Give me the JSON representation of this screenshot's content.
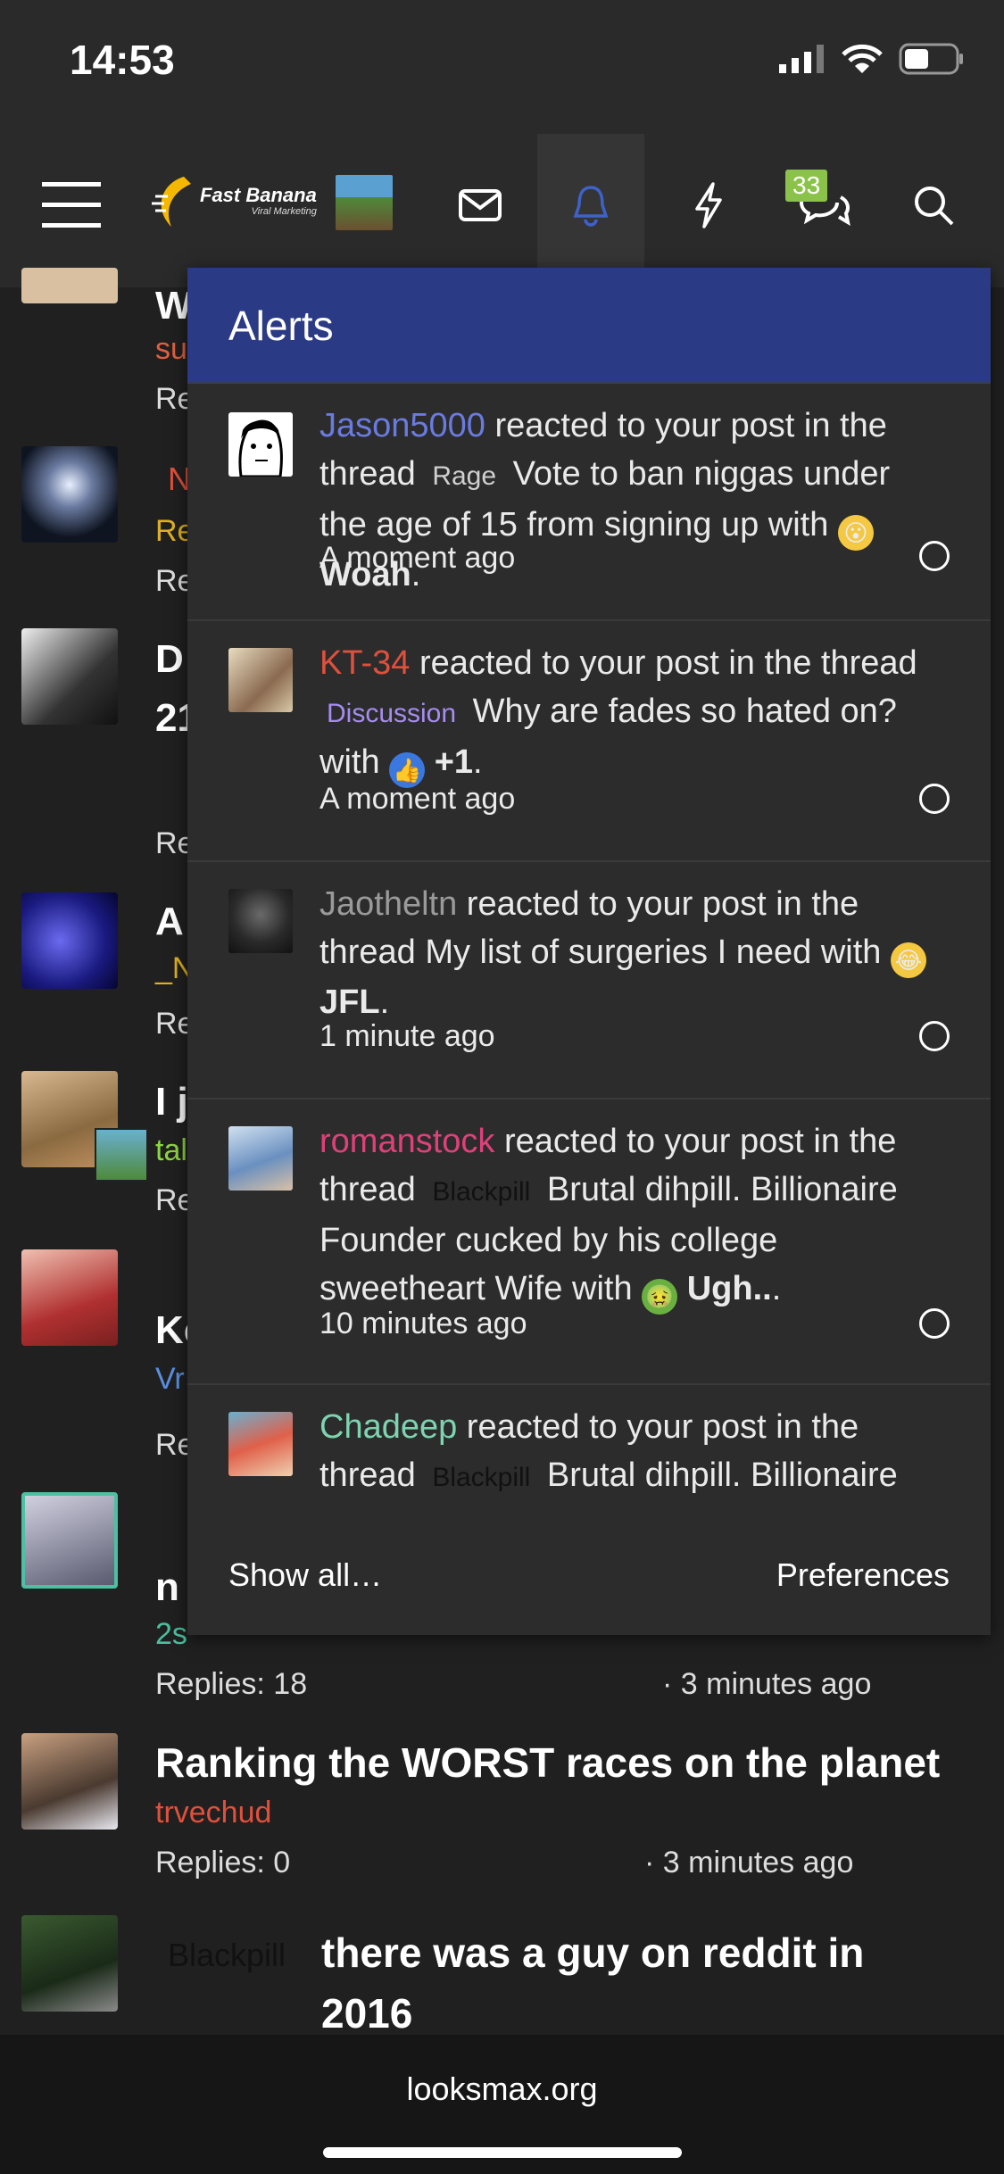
{
  "status": {
    "time": "14:53"
  },
  "nav": {
    "logo_title": "Fast Banana",
    "logo_subtitle": "Viral Marketing",
    "badge_count": "33"
  },
  "threads": [
    {
      "title": "W",
      "author": "su",
      "meta": "Re",
      "author_color": "#e06040"
    },
    {
      "title": "N",
      "author": "Re",
      "meta": "Re",
      "author_color": "#e0b020"
    },
    {
      "title": "D",
      "author": "21",
      "meta": "Re",
      "author_color": "#ffffff"
    },
    {
      "title": "A",
      "author": "_N",
      "meta": "Re",
      "author_color": "#e0b020"
    },
    {
      "title": "I j",
      "author": "tal",
      "meta": "Re",
      "author_color": "#8cd640"
    },
    {
      "title": "Ke",
      "author": "Vr",
      "meta": "Re",
      "author_color": "#5a8fe0"
    },
    {
      "title": "n",
      "author": "2s",
      "meta": "Replies: 18",
      "time": "· 3 minutes ago",
      "author_color": "#4cc0a0"
    },
    {
      "title": "Ranking the WORST races on the planet",
      "author": "trvechud",
      "meta": "Replies: 0",
      "time": "· 3 minutes ago",
      "author_color": "#e0503c"
    },
    {
      "title_prefix": "Blackpill",
      "title": "there was a guy on reddit in 2016",
      "author": "",
      "meta": ""
    }
  ],
  "alerts": {
    "title": "Alerts",
    "items": [
      {
        "user": "Jason5000",
        "user_color": "#6a7be0",
        "text1": " reacted to your post in the thread ",
        "prefix": "Rage",
        "prefix_color": "#cfcfcf",
        "thread": " Vote to ban niggas under the age of 15 from signing up with ",
        "reaction": "Woah",
        "emoji": "😮",
        "time": "A moment ago"
      },
      {
        "user": "KT-34",
        "user_color": "#e0503c",
        "text1": " reacted to your post in the thread ",
        "prefix": "Discussion",
        "prefix_color": "#a68cf0",
        "thread": " Why are fades so hated on? with ",
        "reaction": "+1",
        "emoji": "👍",
        "time": "A moment ago"
      },
      {
        "user": "Jaotheltn",
        "user_color": "#9a9a9a",
        "text1": " reacted to your post in the thread ",
        "prefix": "",
        "prefix_color": "",
        "thread": "My list of surgeries I need with ",
        "reaction": "JFL",
        "emoji": "😂",
        "time": "1 minute ago"
      },
      {
        "user": "romanstock",
        "user_color": "#e0407a",
        "text1": " reacted to your post in the thread ",
        "prefix": "Blackpill",
        "prefix_color": "#111111",
        "thread": " Brutal dihpill. Billionaire Founder cucked by his college sweetheart Wife with ",
        "reaction": "Ugh..",
        "emoji": "🤢",
        "time": "10 minutes ago"
      },
      {
        "user": "Chadeep",
        "user_color": "#7ed3b0",
        "text1": " reacted to your post in the thread ",
        "prefix": "Blackpill",
        "prefix_color": "#111111",
        "thread": " Brutal dihpill. Billionaire",
        "reaction": "",
        "emoji": "",
        "time": ""
      }
    ],
    "show_all": "Show all…",
    "preferences": "Preferences"
  },
  "browser": {
    "url": "looksmax.org"
  }
}
